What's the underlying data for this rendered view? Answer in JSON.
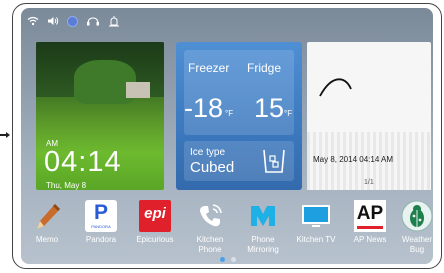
{
  "status_icons": [
    "wifi-icon",
    "volume-icon",
    "notification-dot-icon",
    "headset-icon",
    "alarm-icon"
  ],
  "clock_widget": {
    "ampm": "AM",
    "time": "04:14",
    "date": "Thu, May 8"
  },
  "fridge_widget": {
    "freezer_label": "Freezer",
    "freezer_temp": "-18",
    "freezer_unit": "°F",
    "fridge_label": "Fridge",
    "fridge_temp": "15",
    "fridge_unit": "°F",
    "ice_label": "Ice type",
    "ice_value": "Cubed",
    "accent": "#3e7cc2"
  },
  "memo_widget": {
    "timestamp": "May 8, 2014 04:14 AM",
    "page": "1/1"
  },
  "apps": [
    {
      "label": "Memo",
      "icon": "pencil-icon"
    },
    {
      "label": "Pandora",
      "icon": "pandora-icon"
    },
    {
      "label": "Epicurious",
      "icon": "epi-icon"
    },
    {
      "label": "Kitchen\nPhone",
      "line1": "Kitchen",
      "line2": "Phone",
      "icon": "phone-icon"
    },
    {
      "label": "Phone\nMirroring",
      "line1": "Phone",
      "line2": "Mirroring",
      "icon": "mirroring-icon"
    },
    {
      "label": "Kitchen TV",
      "icon": "tv-icon"
    },
    {
      "label": "AP News",
      "icon": "ap-icon"
    },
    {
      "label": "Weather\nBug",
      "line1": "Weather",
      "line2": "Bug",
      "icon": "weatherbug-icon"
    }
  ],
  "glyphs": {
    "pandora": "P",
    "pandora_small": "PANDORA",
    "epi": "epi",
    "ap": "AP"
  },
  "pager": {
    "pages": 2,
    "active": 1
  }
}
